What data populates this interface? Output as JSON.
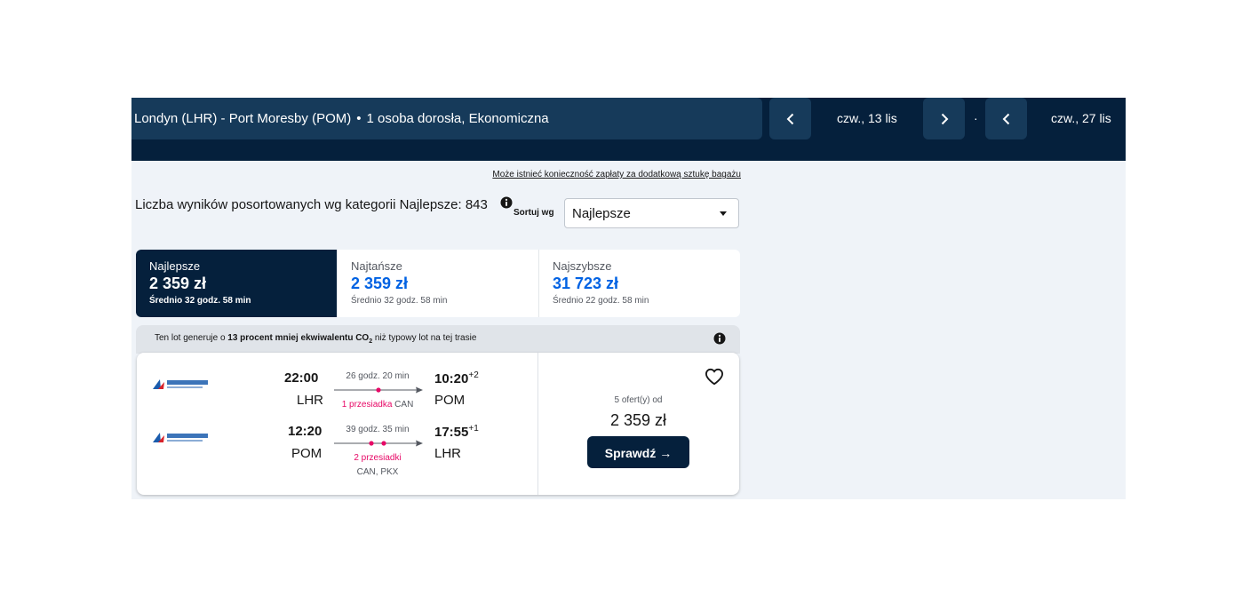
{
  "header": {
    "route": "Londyn (LHR) - Port Moresby (POM)",
    "separator": "•",
    "passengers": "1 osoba dorosła, Ekonomiczna",
    "depart_date": "czw., 13 lis",
    "return_date": "czw., 27 lis",
    "date_separator": "·"
  },
  "results": {
    "baggage_note": "Może istnieć konieczność zapłaty za dodatkową sztukę bagażu",
    "count_text": "Liczba wyników posortowanych wg kategorii Najlepsze: 843",
    "sort_label": "Sortuj wg",
    "sort_value": "Najlepsze"
  },
  "tabs": [
    {
      "label": "Najlepsze",
      "price": "2 359 zł",
      "avg": "Średnio 32 godz. 58 min"
    },
    {
      "label": "Najtańsze",
      "price": "2 359 zł",
      "avg": "Średnio 32 godz. 58 min"
    },
    {
      "label": "Najszybsze",
      "price": "31 723 zł",
      "avg": "Średnio 22 godz. 58 min"
    }
  ],
  "co2": {
    "prefix": "Ten lot generuje o ",
    "bold": "13 procent mniej ekwiwalentu CO",
    "sub": "2",
    "suffix": " niż typowy lot na tej trasie"
  },
  "card": {
    "legs": [
      {
        "dep_time": "22:00",
        "dep_code": "LHR",
        "duration": "26 godz. 20 min",
        "stops": "1 przesiadka",
        "stop_airports": "CAN",
        "arr_time": "10:20",
        "arr_offset": "+2",
        "arr_code": "POM"
      },
      {
        "dep_time": "12:20",
        "dep_code": "POM",
        "duration": "39 godz. 35 min",
        "stops": "2 przesiadki",
        "stop_airports": "CAN, PKX",
        "arr_time": "17:55",
        "arr_offset": "+1",
        "arr_code": "LHR"
      }
    ],
    "airline_logo_text": "中国南方航空",
    "offers": "5 ofert(y) od",
    "price": "2 359 zł",
    "select_label": "Sprawdź →"
  },
  "colors": {
    "navy": "#05203c",
    "route_box": "#163a5a",
    "accent_blue": "#0062e3",
    "stop_pink": "#e70866",
    "airline_blue": "#1a5cad",
    "airline_red": "#d8232a"
  }
}
